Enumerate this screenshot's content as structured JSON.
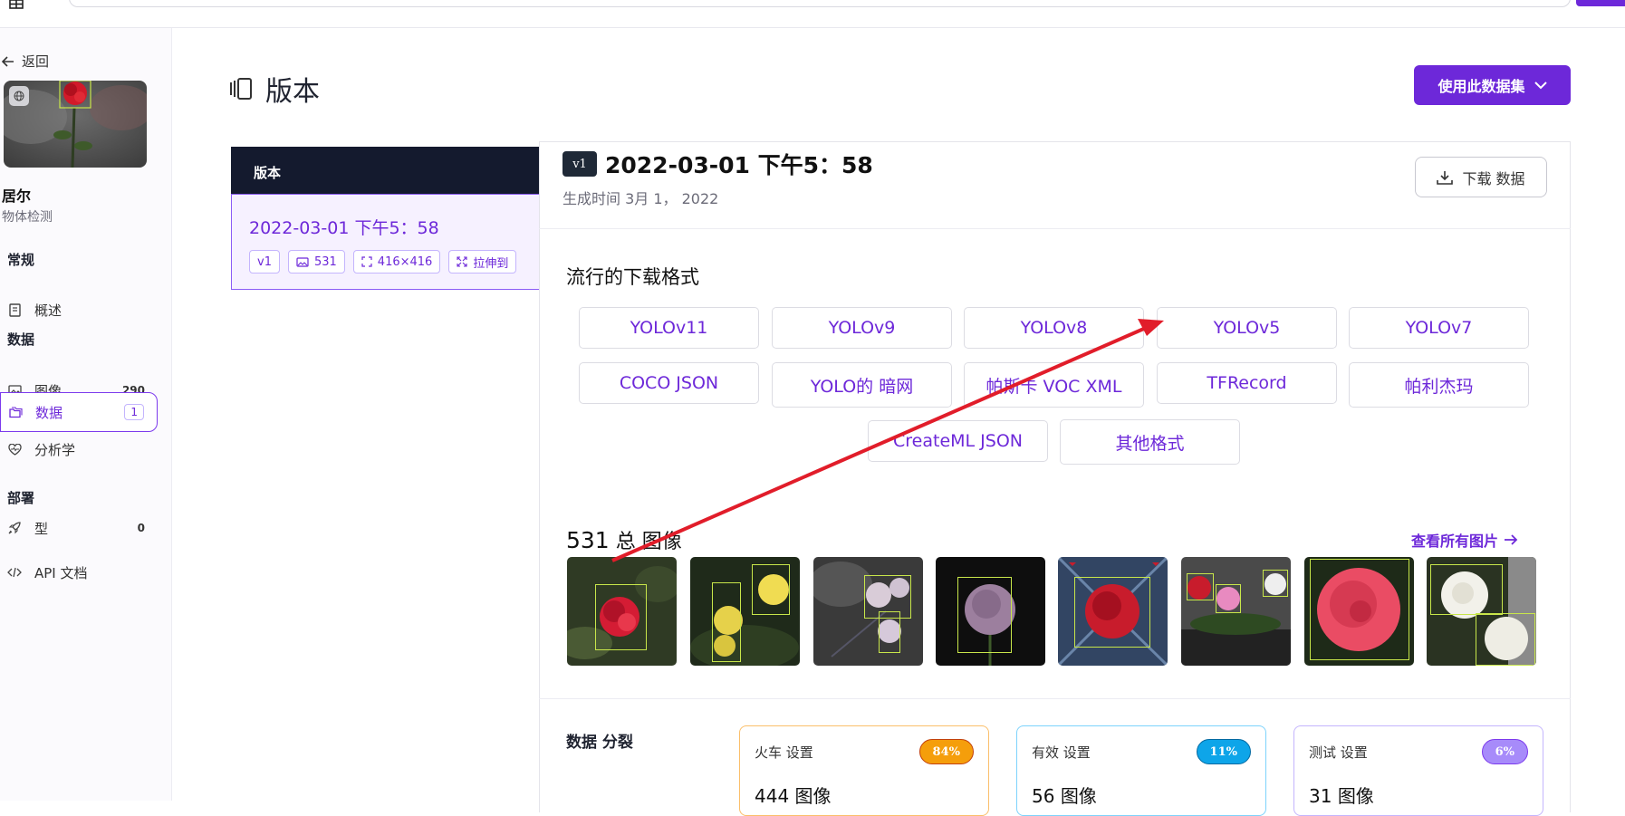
{
  "app": {
    "back_label": "返回"
  },
  "project": {
    "name": "居尔",
    "type": "物体检测"
  },
  "sidebar": {
    "sections": [
      {
        "title": "常规"
      },
      {
        "title": "数据"
      },
      {
        "title": "部署"
      }
    ],
    "items": [
      {
        "label": "概述",
        "icon": "book-icon",
        "count": ""
      },
      {
        "label": "图像",
        "icon": "image-icon",
        "count": "290"
      },
      {
        "label": "数据",
        "icon": "folders-icon",
        "count": "1",
        "active": true
      },
      {
        "label": "分析学",
        "icon": "heart-pulse-icon",
        "count": ""
      },
      {
        "label": "型",
        "icon": "rocket-icon",
        "count": "0"
      },
      {
        "label": "API 文档",
        "icon": "code-icon",
        "count": ""
      }
    ]
  },
  "header": {
    "title": "版本",
    "use_dataset_label": "使用此数据集"
  },
  "versions_panel": {
    "heading": "版本",
    "selected": {
      "title": "2022-03-01 下午5：58",
      "tags": [
        "v1",
        "531",
        "416×416",
        "拉伸到"
      ]
    }
  },
  "version": {
    "badge": "v1",
    "title": "2022-03-01 下午5：58",
    "subtitle": "生成时间 3月 1， 2022",
    "download_label": "下载 数据"
  },
  "formats": {
    "title": "流行的下载格式",
    "items": [
      "YOLOv11",
      "YOLOv9",
      "YOLOv8",
      "YOLOv5",
      "YOLOv7",
      "COCO JSON",
      "YOLO的 暗网",
      "帕斯卡 VOC XML",
      "TFRecord",
      "帕利杰玛",
      "CreateML JSON",
      "其他格式"
    ]
  },
  "images": {
    "count": "531",
    "title_suffix": "总 图像",
    "view_all": "查看所有图片"
  },
  "split": {
    "title": "数据 分裂",
    "sets": [
      {
        "label": "火车 设置",
        "percent": "84%",
        "count": "444",
        "unit": "图像",
        "color": "#f59e0b",
        "border": "#fbbf6a"
      },
      {
        "label": "有效 设置",
        "percent": "11%",
        "count": "56",
        "unit": "图像",
        "color": "#0ea5e9",
        "border": "#7dd3fc"
      },
      {
        "label": "测试 设置",
        "percent": "6%",
        "count": "31",
        "unit": "图像",
        "color": "#a78bfa",
        "border": "#c4b5fd"
      }
    ]
  },
  "colors": {
    "accent": "#6d28d9",
    "dark": "#141a2e",
    "annotation_arrow": "#e11d2a"
  }
}
